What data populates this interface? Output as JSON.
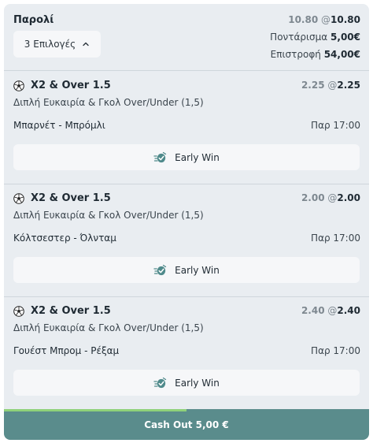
{
  "header": {
    "title": "Παρολί",
    "selections_button": "3 Επιλογές",
    "odds_old": "10.80",
    "odds_at": "@",
    "odds_new": "10.80",
    "stake_label": "Ποντάρισμα",
    "stake_value": "5,00€",
    "return_label": "Επιστροφή",
    "return_value": "54,00€"
  },
  "selections": [
    {
      "market": "X2 & Over 1.5",
      "odds_old": "2.25",
      "odds_new": "2.25",
      "description": "Διπλή Ευκαιρία & Γκολ Over/Under (1,5)",
      "match": "Μπαρνέτ - Μπρόμλι",
      "time": "Παρ 17:00",
      "early_win": "Early Win"
    },
    {
      "market": "X2 & Over 1.5",
      "odds_old": "2.00",
      "odds_new": "2.00",
      "description": "Διπλή Ευκαιρία & Γκολ Over/Under (1,5)",
      "match": "Κόλτσεστερ - Όλνταμ",
      "time": "Παρ 17:00",
      "early_win": "Early Win"
    },
    {
      "market": "X2 & Over 1.5",
      "odds_old": "2.40",
      "odds_new": "2.40",
      "description": "Διπλή Ευκαιρία & Γκολ Over/Under (1,5)",
      "match": "Γουέστ Μπρομ - Ρέξαμ",
      "time": "Παρ 17:00",
      "early_win": "Early Win"
    }
  ],
  "cashout": {
    "label": "Cash Out 5,00 €",
    "progress_fraction": 0.5
  },
  "icons": {
    "sport": "soccer-ball-icon",
    "early_win": "early-win-icon",
    "expand": "chevron-up-icon"
  },
  "colors": {
    "card_bg": "#e9edf1",
    "button_bg": "#f6f7f9",
    "cashout_bg": "#5a8c8c",
    "cashout_progress": "#8fd17a",
    "early_win_icon": "#4f8a8b"
  }
}
